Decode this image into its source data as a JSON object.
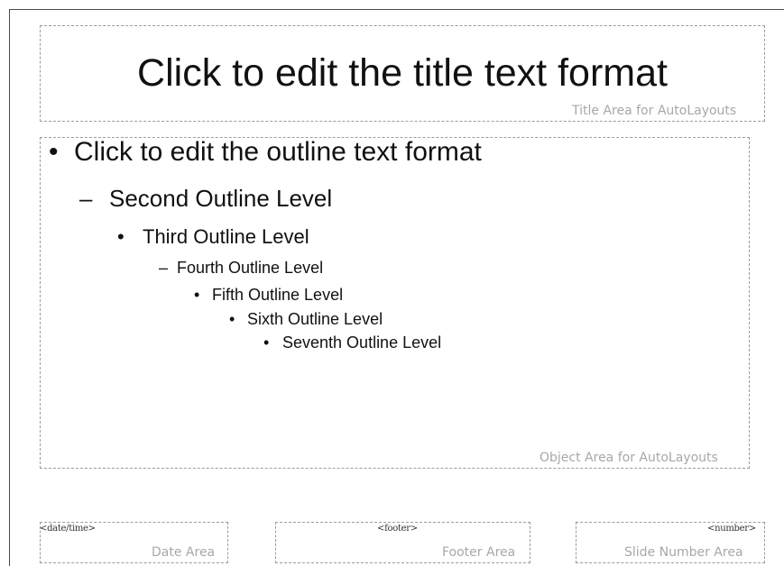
{
  "title_area": {
    "text": "Click to edit the title text format",
    "label": "Title Area for AutoLayouts"
  },
  "object_area": {
    "label": "Object Area for AutoLayouts",
    "levels": [
      {
        "bullet": "•",
        "text": "Click to edit the outline text format"
      },
      {
        "bullet": "–",
        "text": "Second Outline Level"
      },
      {
        "bullet": "•",
        "text": "Third Outline Level"
      },
      {
        "bullet": "–",
        "text": "Fourth Outline Level"
      },
      {
        "bullet": "•",
        "text": "Fifth Outline Level"
      },
      {
        "bullet": "•",
        "text": "Sixth Outline Level"
      },
      {
        "bullet": "•",
        "text": "Seventh Outline Level"
      }
    ]
  },
  "date_area": {
    "field": "<date/time>",
    "label": "Date Area"
  },
  "footer_area": {
    "field": "<footer>",
    "label": "Footer Area"
  },
  "number_area": {
    "field": "<number>",
    "label": "Slide Number Area"
  }
}
